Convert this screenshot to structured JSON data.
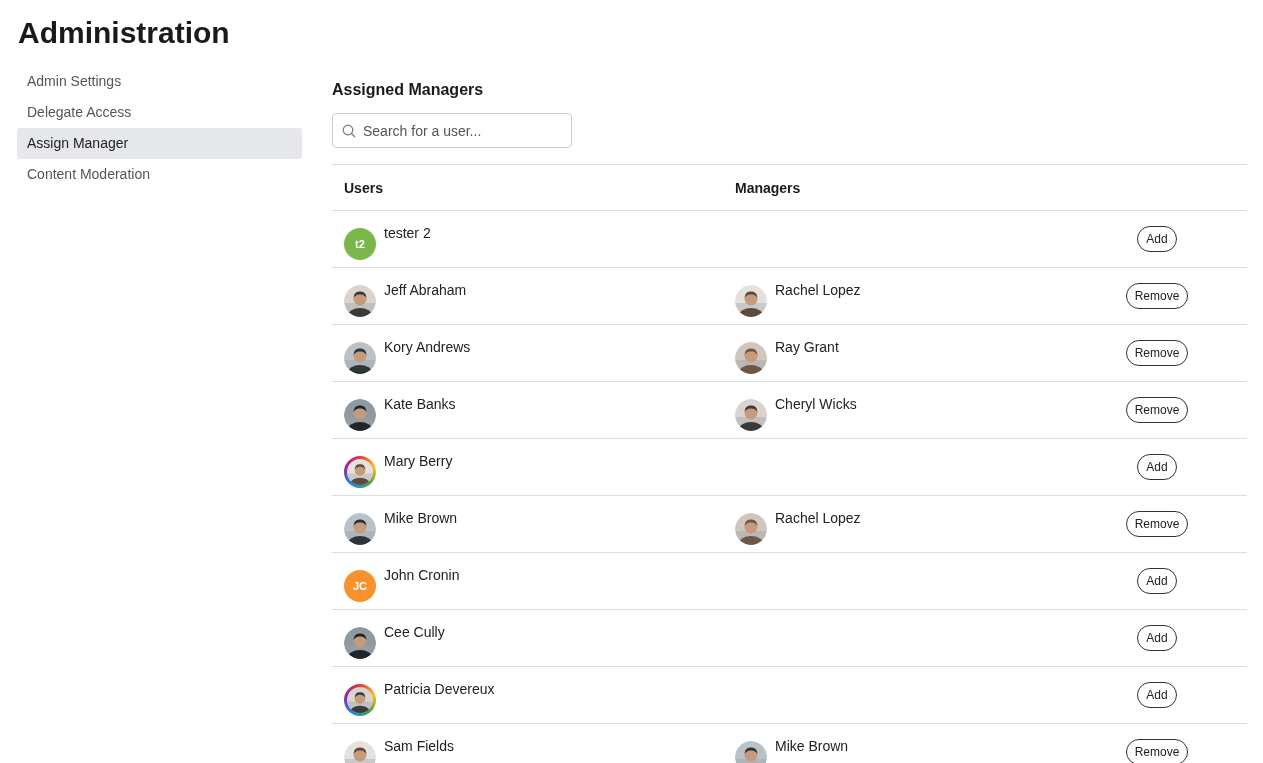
{
  "page_title": "Administration",
  "sidebar": {
    "items": [
      {
        "label": "Admin Settings",
        "selected": false
      },
      {
        "label": "Delegate Access",
        "selected": false
      },
      {
        "label": "Assign Manager",
        "selected": true
      },
      {
        "label": "Content Moderation",
        "selected": false
      }
    ]
  },
  "section_title": "Assigned Managers",
  "search": {
    "placeholder": "Search for a user..."
  },
  "table": {
    "columns": [
      "Users",
      "Managers"
    ],
    "rows": [
      {
        "user": {
          "name": "tester 2",
          "avatar": {
            "kind": "initials",
            "text": "t2",
            "color": "#7ab648"
          }
        },
        "action": "Add"
      },
      {
        "user": {
          "name": "Jeff Abraham",
          "avatar": {
            "kind": "picture"
          }
        },
        "manager": {
          "name": "Rachel Lopez",
          "avatar": {
            "kind": "picture"
          }
        },
        "action": "Remove"
      },
      {
        "user": {
          "name": "Kory Andrews",
          "avatar": {
            "kind": "picture"
          }
        },
        "manager": {
          "name": "Ray Grant",
          "avatar": {
            "kind": "picture"
          }
        },
        "action": "Remove"
      },
      {
        "user": {
          "name": "Kate Banks",
          "avatar": {
            "kind": "picture"
          }
        },
        "manager": {
          "name": "Cheryl Wicks",
          "avatar": {
            "kind": "picture"
          }
        },
        "action": "Remove"
      },
      {
        "user": {
          "name": "Mary Berry",
          "avatar": {
            "kind": "picture",
            "ring": true
          }
        },
        "action": "Add"
      },
      {
        "user": {
          "name": "Mike Brown",
          "avatar": {
            "kind": "picture"
          }
        },
        "manager": {
          "name": "Rachel Lopez",
          "avatar": {
            "kind": "picture"
          }
        },
        "action": "Remove"
      },
      {
        "user": {
          "name": "John Cronin",
          "avatar": {
            "kind": "initials",
            "text": "JC",
            "color": "#f7922e"
          }
        },
        "action": "Add"
      },
      {
        "user": {
          "name": "Cee Cully",
          "avatar": {
            "kind": "picture"
          }
        },
        "action": "Add"
      },
      {
        "user": {
          "name": "Patricia Devereux",
          "avatar": {
            "kind": "picture",
            "ring": true
          }
        },
        "action": "Add"
      },
      {
        "user": {
          "name": "Sam Fields",
          "avatar": {
            "kind": "picture"
          }
        },
        "manager": {
          "name": "Mike Brown",
          "avatar": {
            "kind": "picture"
          }
        },
        "action": "Remove"
      }
    ]
  }
}
